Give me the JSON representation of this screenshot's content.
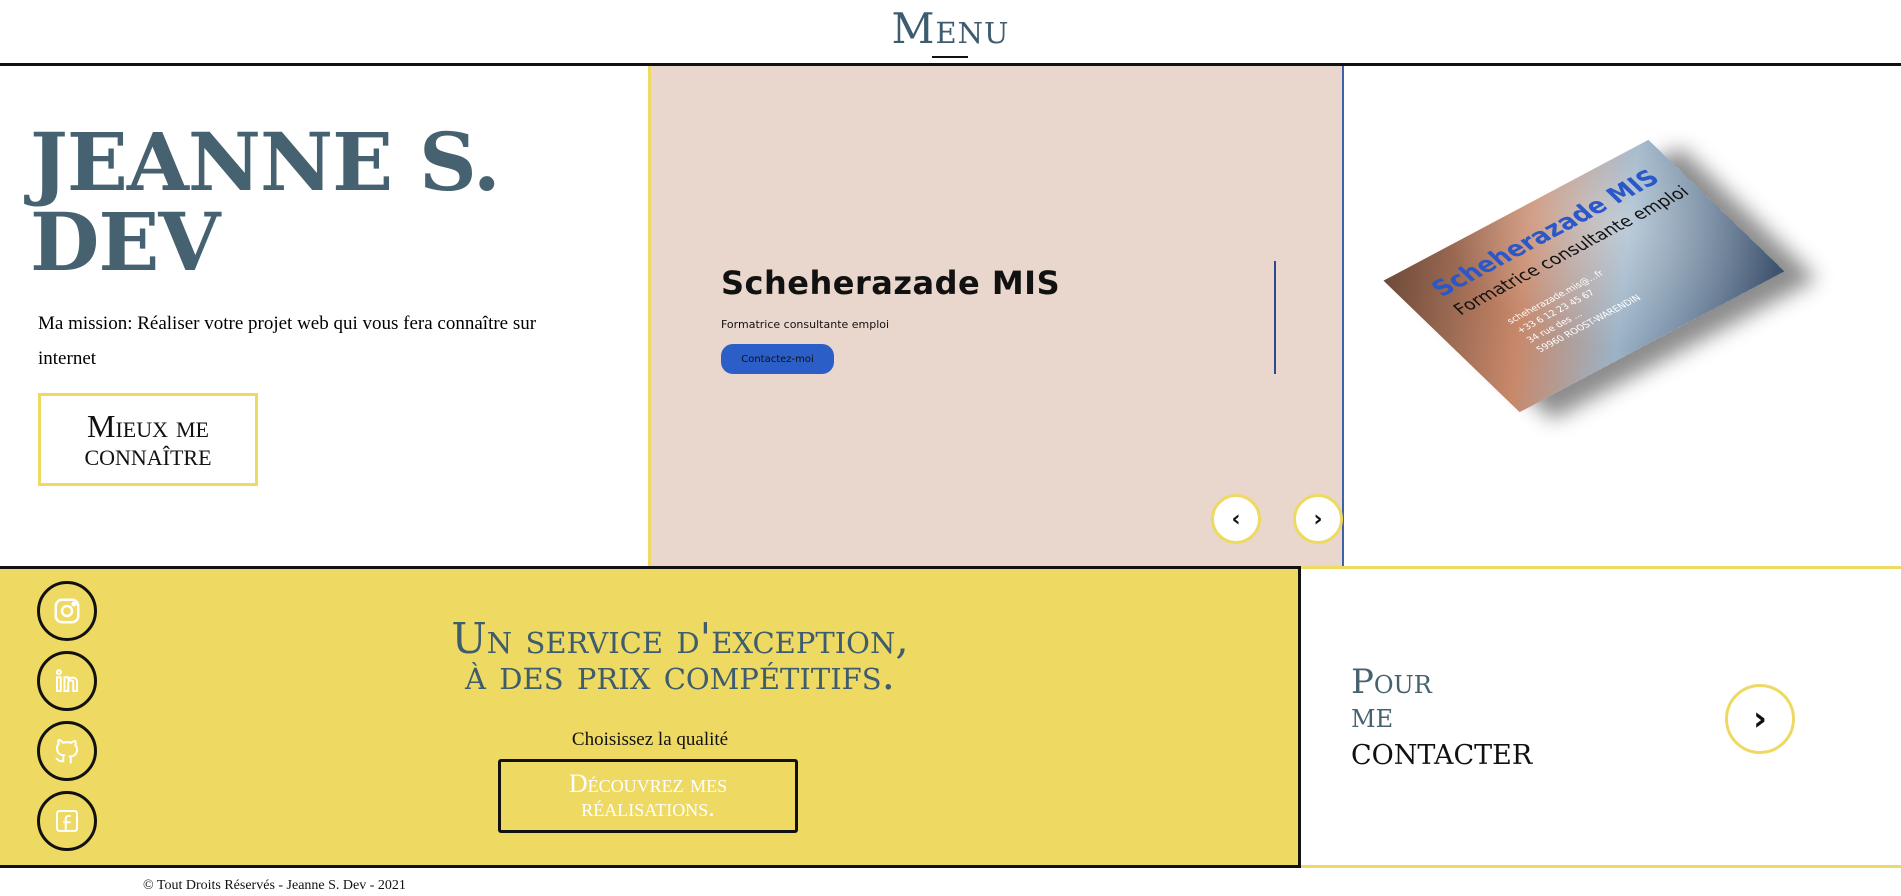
{
  "header": {
    "menu_label": "Menu"
  },
  "hero": {
    "name": "JEANNE S. DEV",
    "mission": "Ma mission: Réaliser votre projet web qui vous fera connaître sur internet",
    "cta_label": "Mieux me connaître"
  },
  "slider": {
    "title": "Scheherazade MIS",
    "subtitle": "Formatrice consultante emploi",
    "cta_label": "Contactez-moi",
    "prev_icon": "chevron-left-icon",
    "next_icon": "chevron-right-icon"
  },
  "card": {
    "name": "Scheherazade MIS",
    "role": "Formatrice consultante emploi",
    "lines": [
      "scheherazade.mis@...fr",
      "+33 6 12 23 45 67",
      "34 rue des ...",
      "59960 ROOST-WARENDIN"
    ]
  },
  "service": {
    "title_line1": "Un service d'exception,",
    "title_line2": "à des prix compétitifs.",
    "subtitle": "Choisissez la qualité",
    "cta_label": "Découvrez mes réalisations.",
    "social": [
      "instagram-icon",
      "linkedin-icon",
      "github-icon",
      "facebook-icon"
    ]
  },
  "contact": {
    "line1": "Pour",
    "line2": "me",
    "line3": "contacter",
    "arrow_icon": "chevron-right-icon"
  },
  "footer": {
    "text": "© Tout Droits Réservés - Jeanne S. Dev - 2021"
  },
  "colors": {
    "accent_yellow": "#eed962",
    "slate_blue": "#466170",
    "slide_bg": "#e9d7cd",
    "button_blue": "#2b5ec6"
  }
}
